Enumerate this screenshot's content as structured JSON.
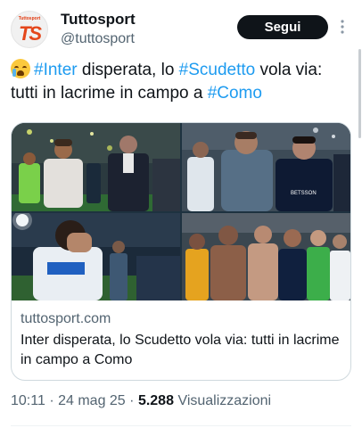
{
  "account": {
    "name": "Tuttosport",
    "handle": "@tuttosport",
    "avatar_text": "Tuttosport",
    "avatar_mark": "TS",
    "follow_label": "Segui",
    "more_icon": "more-vertical-icon"
  },
  "tweet": {
    "emoji": "crying-face-emoji",
    "hashtag_1": "#Inter",
    "text_1": " disperata, lo ",
    "hashtag_2": "#Scudetto",
    "text_2": " vola via: tutti in lacrime in campo a ",
    "hashtag_3": "#Como"
  },
  "link_card": {
    "domain": "tuttosport.com",
    "title": "Inter disperata, lo Scudetto vola via: tutti in lacrime in campo a Como",
    "photos": [
      {
        "name": "photo-players-walking"
      },
      {
        "name": "photo-player-dejected"
      },
      {
        "name": "photo-player-crying"
      },
      {
        "name": "photo-team-huddle"
      }
    ],
    "jersey_text": "BETSSON"
  },
  "meta": {
    "time": "10:11",
    "date": "24 mag 25",
    "separator": "·",
    "views_count": "5.288",
    "views_label": "Visualizzazioni"
  },
  "colors": {
    "link": "#1d9bf0",
    "text": "#0f1419",
    "secondary": "#536471",
    "button": "#0f1419"
  }
}
